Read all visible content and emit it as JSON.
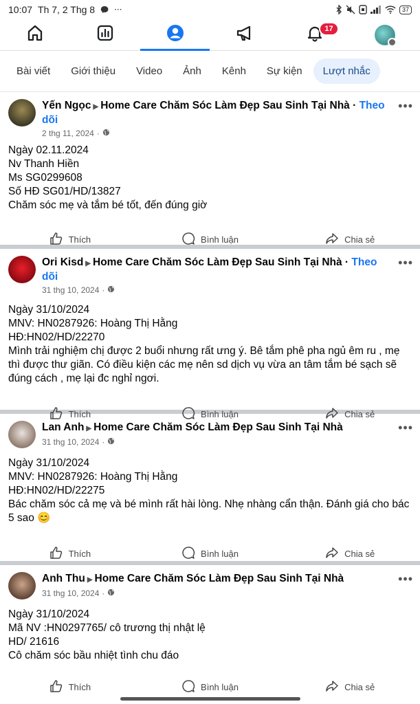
{
  "status": {
    "time": "10:07",
    "date": "Th 7, 2 Thg 8",
    "battery": "37"
  },
  "nav": {
    "notification_count": "17",
    "items": [
      "home-icon",
      "dashboard-icon",
      "profile-icon",
      "megaphone-icon",
      "bell-icon",
      "account-avatar"
    ]
  },
  "tabs": [
    "Bài viết",
    "Giới thiệu",
    "Video",
    "Ảnh",
    "Kênh",
    "Sự kiện",
    "Lượt nhắc"
  ],
  "actions": {
    "like": "Thích",
    "comment": "Bình luận",
    "share": "Chia sẻ"
  },
  "page_name": "Home Care Chăm Sóc Làm Đẹp Sau Sinh Tại Nhà",
  "posts": [
    {
      "author": "Yến Ngọc",
      "follow": "Theo dõi",
      "date": "2 thg 11, 2024",
      "lines": [
        "Ngày 02.11.2024",
        "Nv Thanh Hiền",
        "Ms SG0299608",
        "Số HĐ SG01/HD/13827",
        "Chăm sóc mẹ và tắm bé tốt, đến đúng giờ"
      ]
    },
    {
      "author": "Ori Kisd",
      "follow": "Theo dõi",
      "date": "31 thg 10, 2024",
      "lines": [
        "Ngày 31/10/2024",
        "MNV: HN0287926: Hoàng Thị Hằng",
        "HĐ:HN02/HD/22270",
        "Mình trải nghiệm chị được 2 buổi nhưng rất ưng ý. Bê tắm phê pha ngủ êm ru , mẹ thì được thư giãn. Có điều kiện các mẹ nên sd dịch vụ vừa an tâm tắm bé sạch sẽ đúng cách , mẹ lại đc nghỉ ngơi."
      ]
    },
    {
      "author": "Lan Anh",
      "follow": "",
      "date": "31 thg 10, 2024",
      "lines": [
        "Ngày 31/10/2024",
        "MNV: HN0287926: Hoàng Thị Hằng",
        "HĐ:HN02/HD/22275",
        "Bác chăm sóc cả mẹ và bé mình rất hài lòng. Nhẹ nhàng cẩn thận. Đánh giá cho bác 5 sao 😊"
      ]
    },
    {
      "author": "Anh Thu",
      "follow": "",
      "date": "31 thg 10, 2024",
      "lines": [
        "Ngày 31/10/2024",
        "Mã NV :HN0297765/ cô trương thị nhật lệ",
        "HD/ 21616",
        "Cô chăm sóc bầu nhiệt tình chu đáo"
      ]
    }
  ]
}
